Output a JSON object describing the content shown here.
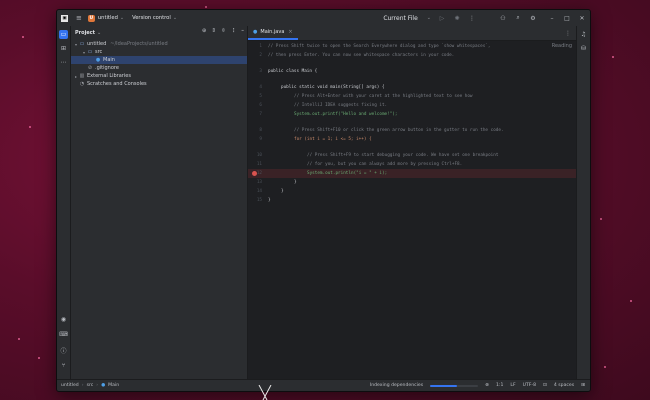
{
  "titlebar": {
    "project_badge": "U",
    "project_name": "untitled",
    "vcs_label": "Version control",
    "run_config": "Current File"
  },
  "project_panel": {
    "title": "Project",
    "tree": [
      {
        "label": "untitled",
        "hint": "~/IdeaProjects/untitled",
        "icon": "folder-icon"
      },
      {
        "label": "src",
        "icon": "folder-icon"
      },
      {
        "label": "Main",
        "icon": "class-icon"
      },
      {
        "label": ".gitignore",
        "icon": "file-icon"
      },
      {
        "label": "External Libraries",
        "icon": "library-icon"
      },
      {
        "label": "Scratches and Consoles",
        "icon": "scratch-icon"
      }
    ]
  },
  "editor": {
    "tab_label": "Main.java",
    "tab_close": "×",
    "reading_mode": "Reading",
    "lines": [
      {
        "n": "1",
        "text": "// Press Shift twice to open the Search Everywhere dialog and type `show whitespaces`,"
      },
      {
        "n": "2",
        "text": "// then press Enter. You can now see whitespace characters in your code."
      },
      {
        "n": "3",
        "text": "public class Main {"
      },
      {
        "n": "4",
        "text": "public static void main(String[] args) {"
      },
      {
        "n": "5",
        "text": "// Press Alt+Enter with your caret at the highlighted text to see how"
      },
      {
        "n": "6",
        "text": "// IntelliJ IDEA suggests fixing it."
      },
      {
        "n": "7",
        "text": "System.out.printf(\"Hello and welcome!\");"
      },
      {
        "n": "8",
        "text": "// Press Shift+F10 or click the green arrow button in the gutter to run the code."
      },
      {
        "n": "9",
        "text": "for (int i = 1; i <= 5; i++) {"
      },
      {
        "n": "10",
        "text": "// Press Shift+F9 to start debugging your code. We have set one breakpoint"
      },
      {
        "n": "11",
        "text": "// for you, but you can always add more by pressing Ctrl+F8."
      },
      {
        "n": "12",
        "text": "System.out.println(\"i = \" + i);"
      },
      {
        "n": "13",
        "text": "}"
      },
      {
        "n": "14",
        "text": "}"
      },
      {
        "n": "15",
        "text": "}"
      }
    ]
  },
  "statusbar": {
    "crumbs": [
      "untitled",
      "src",
      "Main"
    ],
    "progress_text": "Indexing dependencies",
    "progress_fraction": 0.55,
    "position": "1:1",
    "line_sep": "LF",
    "encoding": "UTF-8",
    "indent": "4 spaces"
  },
  "colors": {
    "accent": "#3574f0",
    "breakpoint": "#d9534f",
    "background_desktop": "#5a0d2a"
  }
}
